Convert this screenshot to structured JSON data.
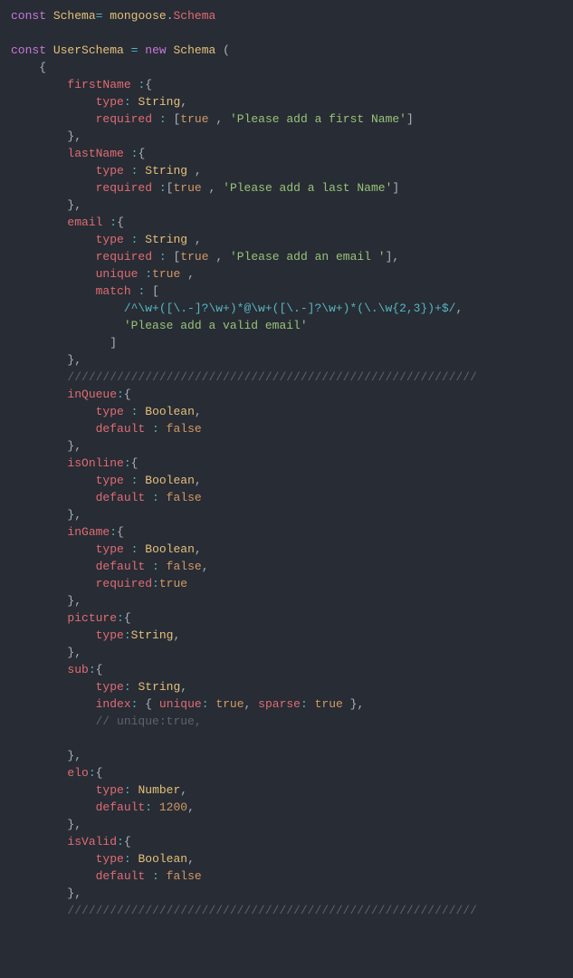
{
  "lines": [
    {
      "tokens": [
        "const",
        "Schema",
        "=",
        "mongoose",
        ".",
        "Schema"
      ]
    },
    {
      "tokens": [
        "const",
        "UserSchema",
        "=",
        "new",
        "Schema",
        "("
      ]
    },
    {
      "tokens": [
        "{"
      ]
    },
    {
      "tokens": [
        "firstName",
        ":",
        "{"
      ]
    },
    {
      "tokens": [
        "type",
        ":",
        "String",
        ","
      ]
    },
    {
      "tokens": [
        "required",
        ":",
        "[",
        "true",
        ",",
        "'Please add a first Name'",
        "]"
      ]
    },
    {
      "tokens": [
        "},"
      ]
    },
    {
      "tokens": [
        "lastName",
        ":",
        "{"
      ]
    },
    {
      "tokens": [
        "type",
        ":",
        "String",
        ","
      ]
    },
    {
      "tokens": [
        "required",
        ":",
        "[",
        "true",
        ",",
        "'Please add a last Name'",
        "]"
      ]
    },
    {
      "tokens": [
        "},"
      ]
    },
    {
      "tokens": [
        "email",
        ":",
        "{"
      ]
    },
    {
      "tokens": [
        "type",
        ":",
        "String",
        ","
      ]
    },
    {
      "tokens": [
        "required",
        ":",
        "[",
        "true",
        ",",
        "'Please add an email '",
        "],"
      ]
    },
    {
      "tokens": [
        "unique",
        ":",
        "true",
        ","
      ]
    },
    {
      "tokens": [
        "match",
        ":",
        "["
      ]
    },
    {
      "tokens": [
        "/^\\w+([\\.-]?\\w+)*@\\w+([\\.-]?\\w+)*(\\.\\w{2,3})+$/",
        ","
      ]
    },
    {
      "tokens": [
        "'Please add a valid email'"
      ]
    },
    {
      "tokens": [
        "]"
      ]
    },
    {
      "tokens": [
        "},"
      ]
    },
    {
      "tokens": [
        "//////////////////////////////////////////////////////////"
      ]
    },
    {
      "tokens": [
        "inQueue",
        ":",
        "{"
      ]
    },
    {
      "tokens": [
        "type",
        ":",
        "Boolean",
        ","
      ]
    },
    {
      "tokens": [
        "default",
        ":",
        "false"
      ]
    },
    {
      "tokens": [
        "},"
      ]
    },
    {
      "tokens": [
        "isOnline",
        ":",
        "{"
      ]
    },
    {
      "tokens": [
        "type",
        ":",
        "Boolean",
        ","
      ]
    },
    {
      "tokens": [
        "default",
        ":",
        "false"
      ]
    },
    {
      "tokens": [
        "},"
      ]
    },
    {
      "tokens": [
        "inGame",
        ":",
        "{"
      ]
    },
    {
      "tokens": [
        "type",
        ":",
        "Boolean",
        ","
      ]
    },
    {
      "tokens": [
        "default",
        ":",
        "false",
        ","
      ]
    },
    {
      "tokens": [
        "required",
        ":",
        "true"
      ]
    },
    {
      "tokens": [
        "},"
      ]
    },
    {
      "tokens": [
        "picture",
        ":",
        "{"
      ]
    },
    {
      "tokens": [
        "type",
        ":",
        "String",
        ","
      ]
    },
    {
      "tokens": [
        "},"
      ]
    },
    {
      "tokens": [
        "sub",
        ":",
        "{"
      ]
    },
    {
      "tokens": [
        "type",
        ":",
        "String",
        ","
      ]
    },
    {
      "tokens": [
        "index",
        ":",
        "{",
        "unique",
        ":",
        "true",
        ",",
        "sparse",
        ":",
        "true",
        "},"
      ]
    },
    {
      "tokens": [
        "// unique:true,"
      ]
    },
    {
      "tokens": [
        "},"
      ]
    },
    {
      "tokens": [
        "elo",
        ":",
        "{"
      ]
    },
    {
      "tokens": [
        "type",
        ":",
        "Number",
        ","
      ]
    },
    {
      "tokens": [
        "default",
        ":",
        "1200",
        ","
      ]
    },
    {
      "tokens": [
        "},"
      ]
    },
    {
      "tokens": [
        "isValid",
        ":",
        "{"
      ]
    },
    {
      "tokens": [
        "type",
        ":",
        "Boolean",
        ","
      ]
    },
    {
      "tokens": [
        "default",
        ":",
        "false"
      ]
    },
    {
      "tokens": [
        "},"
      ]
    },
    {
      "tokens": [
        "//////////////////////////////////////////////////////////"
      ]
    }
  ]
}
